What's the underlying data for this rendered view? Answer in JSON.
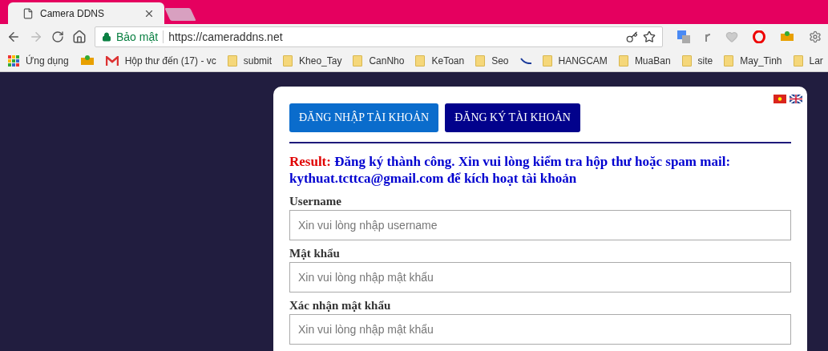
{
  "browser": {
    "tabs": [
      {
        "title": "Camera DDNS",
        "selected": true
      }
    ],
    "security_label": "Bảo mật",
    "url": "https://cameraddns.net",
    "bookmarks": [
      {
        "kind": "apps",
        "label": "Ứng dụng"
      },
      {
        "kind": "sq"
      },
      {
        "kind": "mail",
        "label": "Hộp thư đến (17) - vc"
      },
      {
        "kind": "folder",
        "label": "submit"
      },
      {
        "kind": "folder",
        "label": "Kheo_Tay"
      },
      {
        "kind": "folder",
        "label": "CanNho"
      },
      {
        "kind": "folder",
        "label": "KeToan"
      },
      {
        "kind": "folder",
        "label": "Seo"
      },
      {
        "kind": "swoosh"
      },
      {
        "kind": "folder",
        "label": "HANGCAM"
      },
      {
        "kind": "folder",
        "label": "MuaBan"
      },
      {
        "kind": "folder",
        "label": "site"
      },
      {
        "kind": "folder",
        "label": "May_Tinh"
      },
      {
        "kind": "folder",
        "label": "Lar"
      }
    ]
  },
  "card": {
    "tabs": [
      {
        "label": "ĐĂNG NHẬP TÀI KHOẢN",
        "selected": false
      },
      {
        "label": "ĐĂNG KÝ TÀI KHOẢN",
        "selected": true
      }
    ],
    "result": {
      "label": "Result:",
      "message": "Đăng ký thành công. Xin vui lòng kiểm tra hộp thư hoặc spam mail: kythuat.tcttca@gmail.com để kích hoạt tài khoản"
    },
    "fields": [
      {
        "label": "Username",
        "placeholder": "Xin vui lòng nhập username"
      },
      {
        "label": "Mật khẩu",
        "placeholder": "Xin vui lòng nhập mật khẩu"
      },
      {
        "label": "Xác nhận mật khẩu",
        "placeholder": "Xin vui lòng nhập mật khẩu"
      }
    ]
  }
}
